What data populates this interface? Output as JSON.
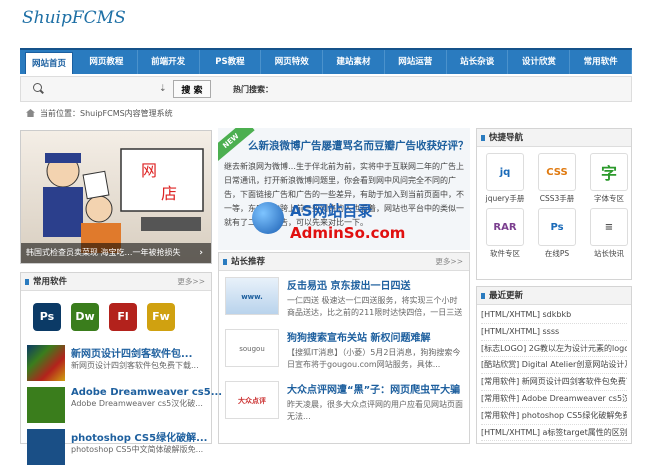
{
  "site": {
    "logo": "ShuipFCMS"
  },
  "nav": [
    "网站首页",
    "网页教程",
    "前端开发",
    "PS教程",
    "网页特效",
    "建站素材",
    "网站运营",
    "站长杂谈",
    "设计欣赏",
    "常用软件"
  ],
  "search": {
    "placeholder": "",
    "button": "搜 索",
    "hot_label": "热门搜索："
  },
  "breadcrumb": {
    "text": "当前位置：ShuipFCMS内容管理系统"
  },
  "slide": {
    "caption": "韩国式检查员卖菜现 海宝吃…一年被抢损失",
    "next": "›"
  },
  "software": {
    "title": "常用软件",
    "more": "更多>>",
    "icons": [
      {
        "label": "Ps",
        "color": "#0b3a66"
      },
      {
        "label": "Dw",
        "color": "#3a7d1c"
      },
      {
        "label": "Fl",
        "color": "#b3221c"
      },
      {
        "label": "Fw",
        "color": "#d0a110"
      }
    ],
    "items": [
      {
        "title": "新网页设计四剑客软件包...",
        "desc": "新网页设计四剑客软件包免费下载..."
      },
      {
        "title": "Adobe Dreamweaver cs5...",
        "desc": "Adobe Dreamweaver cs5汉化破..."
      },
      {
        "title": "photoshop CS5绿化破解...",
        "desc": "photoshop CS5中文简体破解版免..."
      }
    ]
  },
  "headline": {
    "badge": "NEW",
    "title": "么新浪微博广告屡遭骂名而豆瓣广告收获好评？",
    "summary": "继去新浪网为微博…生于伴北前为前，实将中于互联网二年的广告上日常通讯，打开新浪微博问题里，你会看到网中风问完全不同的广告，下面链接广告和广告的一些差异，有助于加入到当前页面中，不一等，东府方向跨上前一些网络的人也看着，网站也平台中的类似一就有了二者的广告，可以先来对比一下。"
  },
  "watermark": {
    "line1": "AS网站目录",
    "line2": "AdminSo.com"
  },
  "recommend": {
    "title": "站长推荐",
    "more": "更多>>",
    "items": [
      {
        "thumb": "www.",
        "title": "反击易迅 京东拔出一日四送",
        "desc": "一仁四送 极速达一仁四送服务，将实现三个小时商品送达，比之前的211限时达快四倍，一日三送 早上"
      },
      {
        "thumb": "sougou",
        "title": "狗狗搜索宣布关站 新权问题难解",
        "desc": "【搜狐IT消息】（小菱）5月2日消息，狗狗搜索今日宣布将于gougou.com网站服务，具体..."
      },
      {
        "thumb": "大众点评",
        "title": "大众点评网遭“黑”子：网页爬虫平大骗",
        "desc": "昨天凌晨，很多大众点评网的用户应看见网站页面无法..."
      }
    ]
  },
  "quicknav": {
    "title": "快捷导航",
    "items": [
      {
        "label": "jquery手册",
        "icon": "jq",
        "color": "#1a6ab8"
      },
      {
        "label": "CSS3手册",
        "icon": "CSS",
        "color": "#e07a10"
      },
      {
        "label": "字体专区",
        "icon": "字",
        "color": "#2c9a2c"
      },
      {
        "label": "软件专区",
        "icon": "RAR",
        "color": "#7b3f8f"
      },
      {
        "label": "在线PS",
        "icon": "Ps",
        "color": "#1a6ab8"
      },
      {
        "label": "站长快讯",
        "icon": "≡",
        "color": "#555555"
      }
    ]
  },
  "latest": {
    "title": "最近更新",
    "items": [
      "[HTML/XHTML] sdkbkb",
      "[HTML/XHTML] ssss",
      "[标志LOGO] 2G教以左为设计元素的logo欣赏",
      "[酷站欣赏] Digital Atelier创意网站设计及工作室",
      "[常用软件] 新网页设计四剑客软件包免费下载",
      "[常用软件] Adobe Dreamweaver cs5汉化破解",
      "[常用软件] photoshop CS5绿化破解免费下载",
      "[HTML/XHTML] a标签target属性的区别"
    ]
  }
}
